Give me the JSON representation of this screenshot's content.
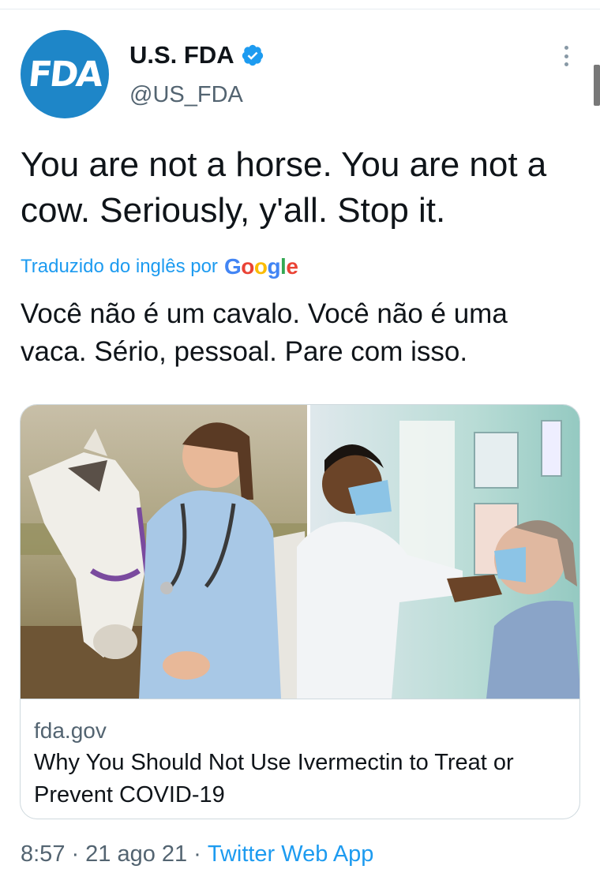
{
  "author": {
    "display_name": "U.S. FDA",
    "handle": "@US_FDA",
    "avatar_text": "FDA",
    "verified": true
  },
  "tweet": {
    "text": "You are not a horse. You are not a cow. Seriously, y'all. Stop it.",
    "translated_label": "Traduzido do inglês por",
    "translation_provider": "Google",
    "translation": "Você não é um cavalo. Você não é uma vaca. Sério, pessoal. Pare com isso."
  },
  "link_card": {
    "domain": "fda.gov",
    "title": "Why You Should Not Use Ivermectin to Treat or Prevent COVID-19"
  },
  "meta": {
    "time": "8:57",
    "date": "21 ago 21",
    "separator": "·",
    "source": "Twitter Web App"
  },
  "colors": {
    "accent": "#1d9bf0",
    "avatar_bg": "#1e86c8",
    "secondary_text": "#536471",
    "border": "#cfd9de"
  },
  "icons": {
    "verified": "verified-badge-icon",
    "more": "more-options-icon"
  }
}
